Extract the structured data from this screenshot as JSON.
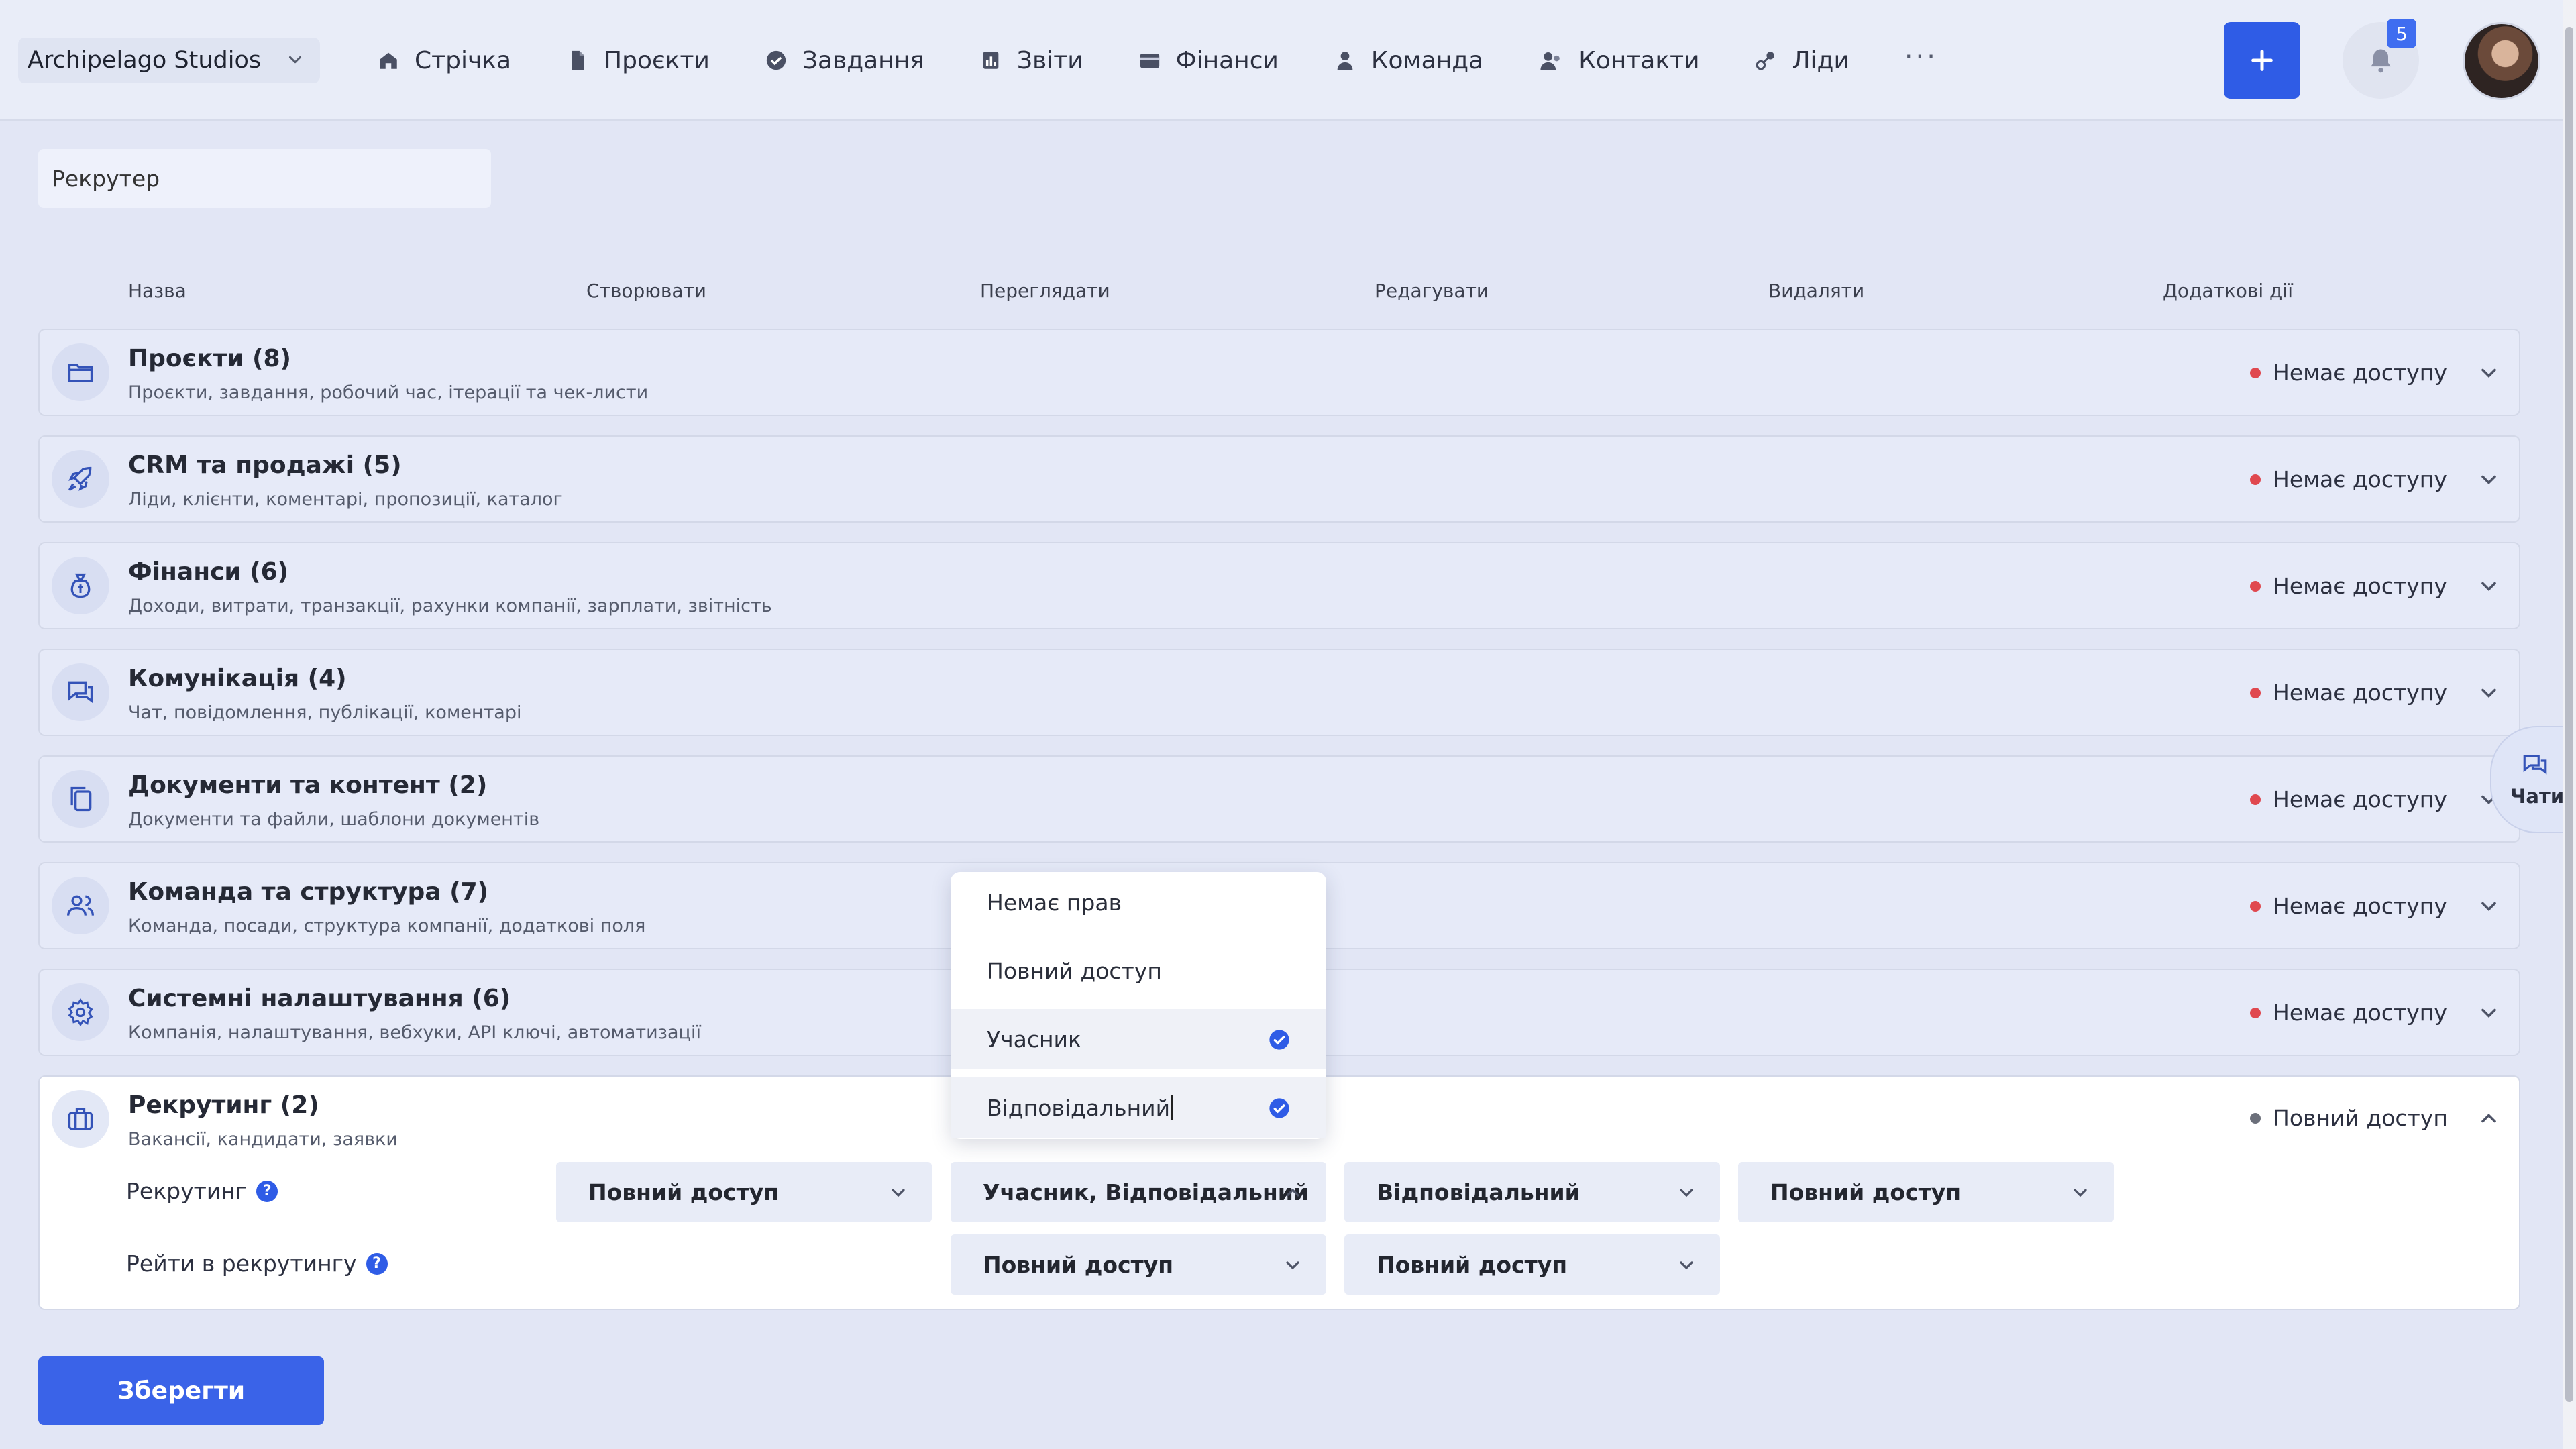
{
  "company": {
    "name": "Archipelago Studios"
  },
  "nav": {
    "items": [
      {
        "label": "Стрічка",
        "icon": "home-icon"
      },
      {
        "label": "Проєкти",
        "icon": "document-icon"
      },
      {
        "label": "Завдання",
        "icon": "check-circle-icon"
      },
      {
        "label": "Звіти",
        "icon": "chart-icon"
      },
      {
        "label": "Фінанси",
        "icon": "wallet-icon"
      },
      {
        "label": "Команда",
        "icon": "person-icon"
      },
      {
        "label": "Контакти",
        "icon": "contacts-icon"
      },
      {
        "label": "Ліди",
        "icon": "leads-icon"
      }
    ],
    "more": "···"
  },
  "notifications": {
    "count": "5"
  },
  "role": {
    "value": "Рекрутер"
  },
  "columns": [
    "Назва",
    "Створювати",
    "Переглядати",
    "Редагувати",
    "Видаляти",
    "Додаткові дії"
  ],
  "sections": [
    {
      "title": "Проєкти (8)",
      "subtitle": "Проєкти, завдання, робочий час, ітерації та чек-листи",
      "status": "Немає доступу",
      "icon": "folder-icon"
    },
    {
      "title": "CRM та продажі (5)",
      "subtitle": "Ліди, клієнти, коментарі, пропозиції, каталог",
      "status": "Немає доступу",
      "icon": "rocket-icon"
    },
    {
      "title": "Фінанси (6)",
      "subtitle": "Доходи, витрати, транзакції, рахунки компанії, зарплати, звітність",
      "status": "Немає доступу",
      "icon": "money-bag-icon"
    },
    {
      "title": "Комунікація (4)",
      "subtitle": "Чат, повідомлення, публікації, коментарі",
      "status": "Немає доступу",
      "icon": "chat-icon"
    },
    {
      "title": "Документи та контент (2)",
      "subtitle": "Документи та файли, шаблони документів",
      "status": "Немає доступу",
      "icon": "copy-icon"
    },
    {
      "title": "Команда та структура (7)",
      "subtitle": "Команда, посади, структура компанії, додаткові поля",
      "status": "Немає доступу",
      "icon": "people-icon"
    },
    {
      "title": "Системні налаштування (6)",
      "subtitle": "Компанія, налаштування, вебхуки, API ключі, автоматизації",
      "status": "Немає доступу",
      "icon": "gear-icon"
    },
    {
      "title": "Рекрутинг (2)",
      "subtitle": "Вакансії, кандидати, заявки",
      "status": "Повний доступ",
      "icon": "briefcase-icon"
    }
  ],
  "recruiting": {
    "rows": [
      {
        "label": "Рекрутинг",
        "create": "Повний доступ",
        "view": "Учасник, Відповідальний",
        "edit": "Відповідальний",
        "delete": "Повний доступ"
      },
      {
        "label": "Рейти в рекрутингу",
        "view": "Повний доступ",
        "edit": "Повний доступ"
      }
    ]
  },
  "dropdown": {
    "options": [
      {
        "label": "Немає прав",
        "checked": false
      },
      {
        "label": "Повний доступ",
        "checked": false
      },
      {
        "label": "Учасник",
        "checked": true
      },
      {
        "label": "Відповідальний",
        "checked": true
      }
    ]
  },
  "chat_fab": {
    "label": "Чати"
  },
  "save_label": "Зберегти",
  "colors": {
    "accent": "#2f5ce6",
    "no_access": "#e0484f",
    "full_access": "#6b6f7a"
  }
}
